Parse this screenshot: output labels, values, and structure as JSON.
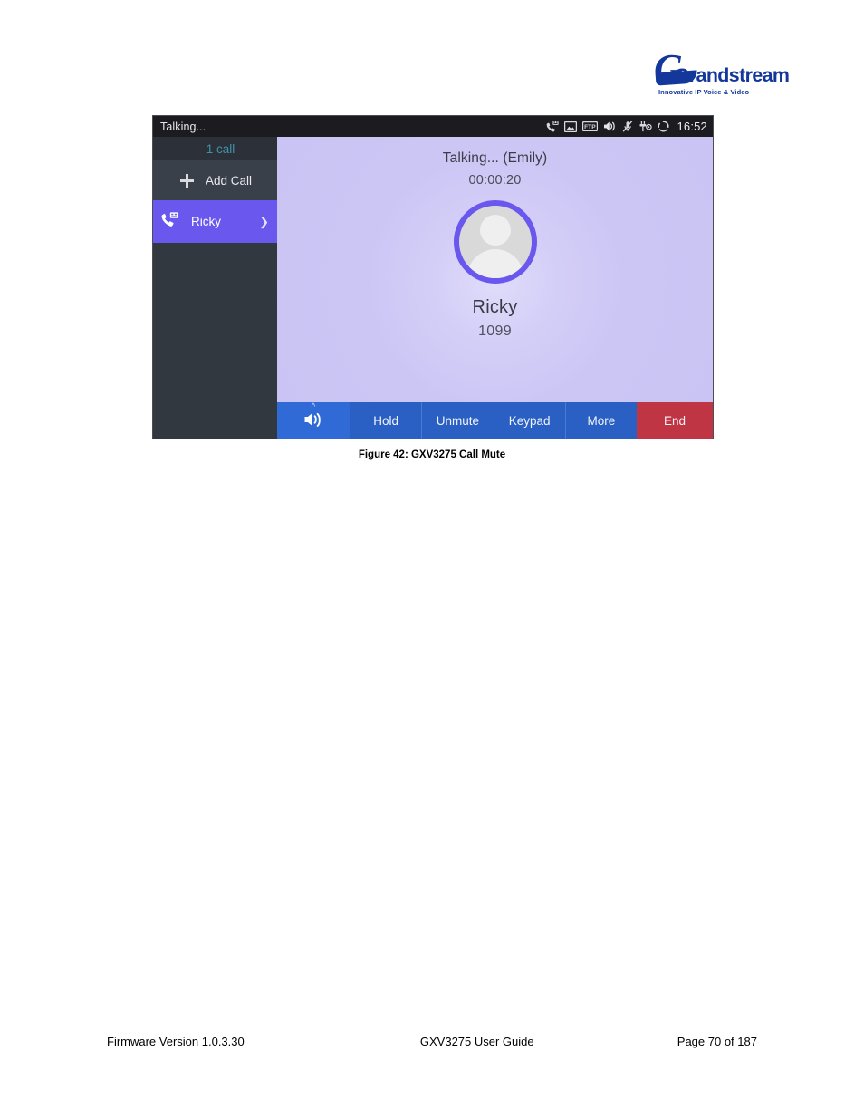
{
  "brand": {
    "name": "Grandstream",
    "initial": "G",
    "tagline": "Innovative IP Voice & Video"
  },
  "phone": {
    "status_bar": {
      "title": "Talking...",
      "clock": "16:52",
      "icons": [
        "missed-call-icon",
        "image-icon",
        "ftp-icon",
        "speaker-icon",
        "mic-muted-icon",
        "headset-icon",
        "sync-icon"
      ],
      "ftp_label": "FTP"
    },
    "sidebar": {
      "call_count": "1 call",
      "add_call_label": "Add Call",
      "calls": [
        {
          "name": "Ricky",
          "selected": true
        }
      ]
    },
    "call": {
      "status": "Talking... (Emily)",
      "duration": "00:00:20",
      "contact_name": "Ricky",
      "contact_number": "1099"
    },
    "actions": {
      "speaker_label": "",
      "buttons": [
        {
          "label": "Hold",
          "kind": "normal"
        },
        {
          "label": "Unmute",
          "kind": "normal"
        },
        {
          "label": "Keypad",
          "kind": "normal"
        },
        {
          "label": "More",
          "kind": "normal"
        },
        {
          "label": "End",
          "kind": "end"
        }
      ]
    },
    "colors": {
      "accent_purple": "#6a57ee",
      "panel_lavender": "#ccc6f5",
      "action_blue": "#2a5fc4",
      "end_red": "#c03543",
      "sidebar_dark": "#32383f",
      "status_dark": "#1b1b20",
      "call_count_teal": "#3f93a5",
      "brand_blue": "#14379b"
    }
  },
  "caption": "Figure 42: GXV3275 Call Mute",
  "footer": {
    "left": "Firmware Version 1.0.3.30",
    "center": "GXV3275 User Guide",
    "right": "Page 70 of 187"
  }
}
